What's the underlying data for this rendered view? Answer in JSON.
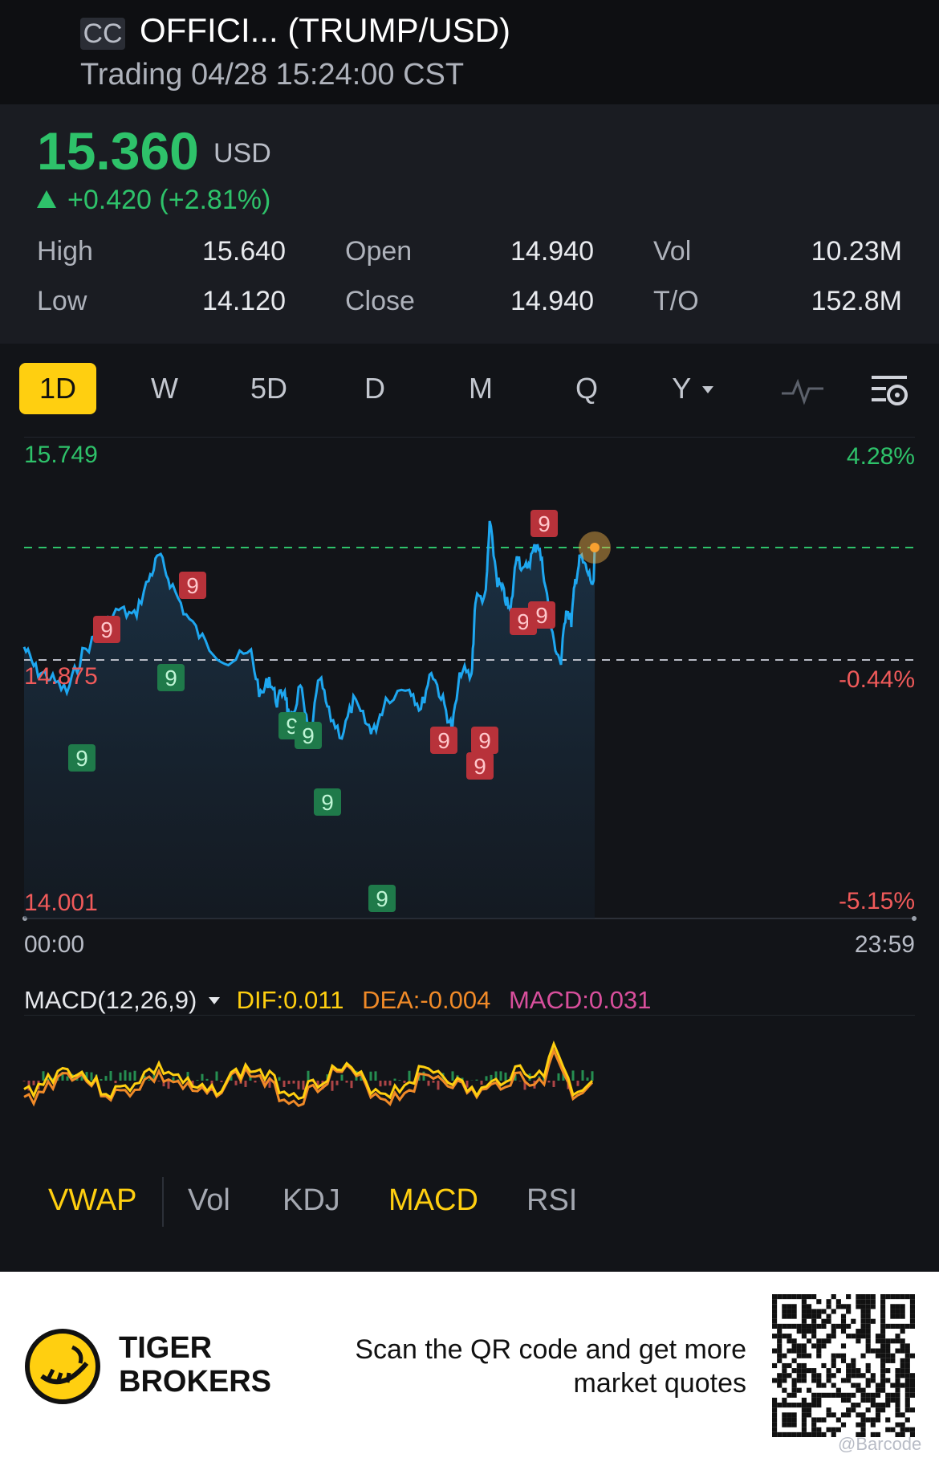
{
  "header": {
    "badge": "CC",
    "asset_name": "OFFICI...   (TRUMP/USD)",
    "status": "Trading 04/28 15:24:00 CST"
  },
  "quote": {
    "price": "15.360",
    "currency": "USD",
    "change": "+0.420 (+2.81%)",
    "stats": [
      {
        "label": "High",
        "value": "15.640"
      },
      {
        "label": "Low",
        "value": "14.120"
      },
      {
        "label": "Open",
        "value": "14.940"
      },
      {
        "label": "Close",
        "value": "14.940"
      },
      {
        "label": "Vol",
        "value": "10.23M"
      },
      {
        "label": "T/O",
        "value": "152.8M"
      }
    ]
  },
  "period_tabs": {
    "items": [
      "1D",
      "W",
      "5D",
      "D",
      "M",
      "Q",
      "Y"
    ],
    "active": "1D"
  },
  "chart": {
    "y_top_price": "15.749",
    "y_top_pct": "4.28%",
    "y_mid_price": "14.875",
    "y_mid_pct": "-0.44%",
    "y_bottom_price": "14.001",
    "y_bottom_pct": "-5.15%",
    "x_start": "00:00",
    "x_end": "23:59",
    "signal_label": "9",
    "colors": {
      "line": "#1ea7f0",
      "up": "#2ec26a",
      "down": "#f05a5a",
      "accent": "#ffcf10"
    }
  },
  "macd": {
    "title": "MACD(12,26,9)",
    "dif": "DIF:0.011",
    "dea": "DEA:-0.004",
    "macd": "MACD:0.031"
  },
  "indicator_tabs": {
    "items": [
      "VWAP",
      "Vol",
      "KDJ",
      "MACD",
      "RSI"
    ]
  },
  "footer": {
    "brand_line1": "TIGER",
    "brand_line2": "BROKERS",
    "promo_line1": "Scan the QR code and get more",
    "promo_line2": "market quotes",
    "watermark": "@Barcode"
  }
}
